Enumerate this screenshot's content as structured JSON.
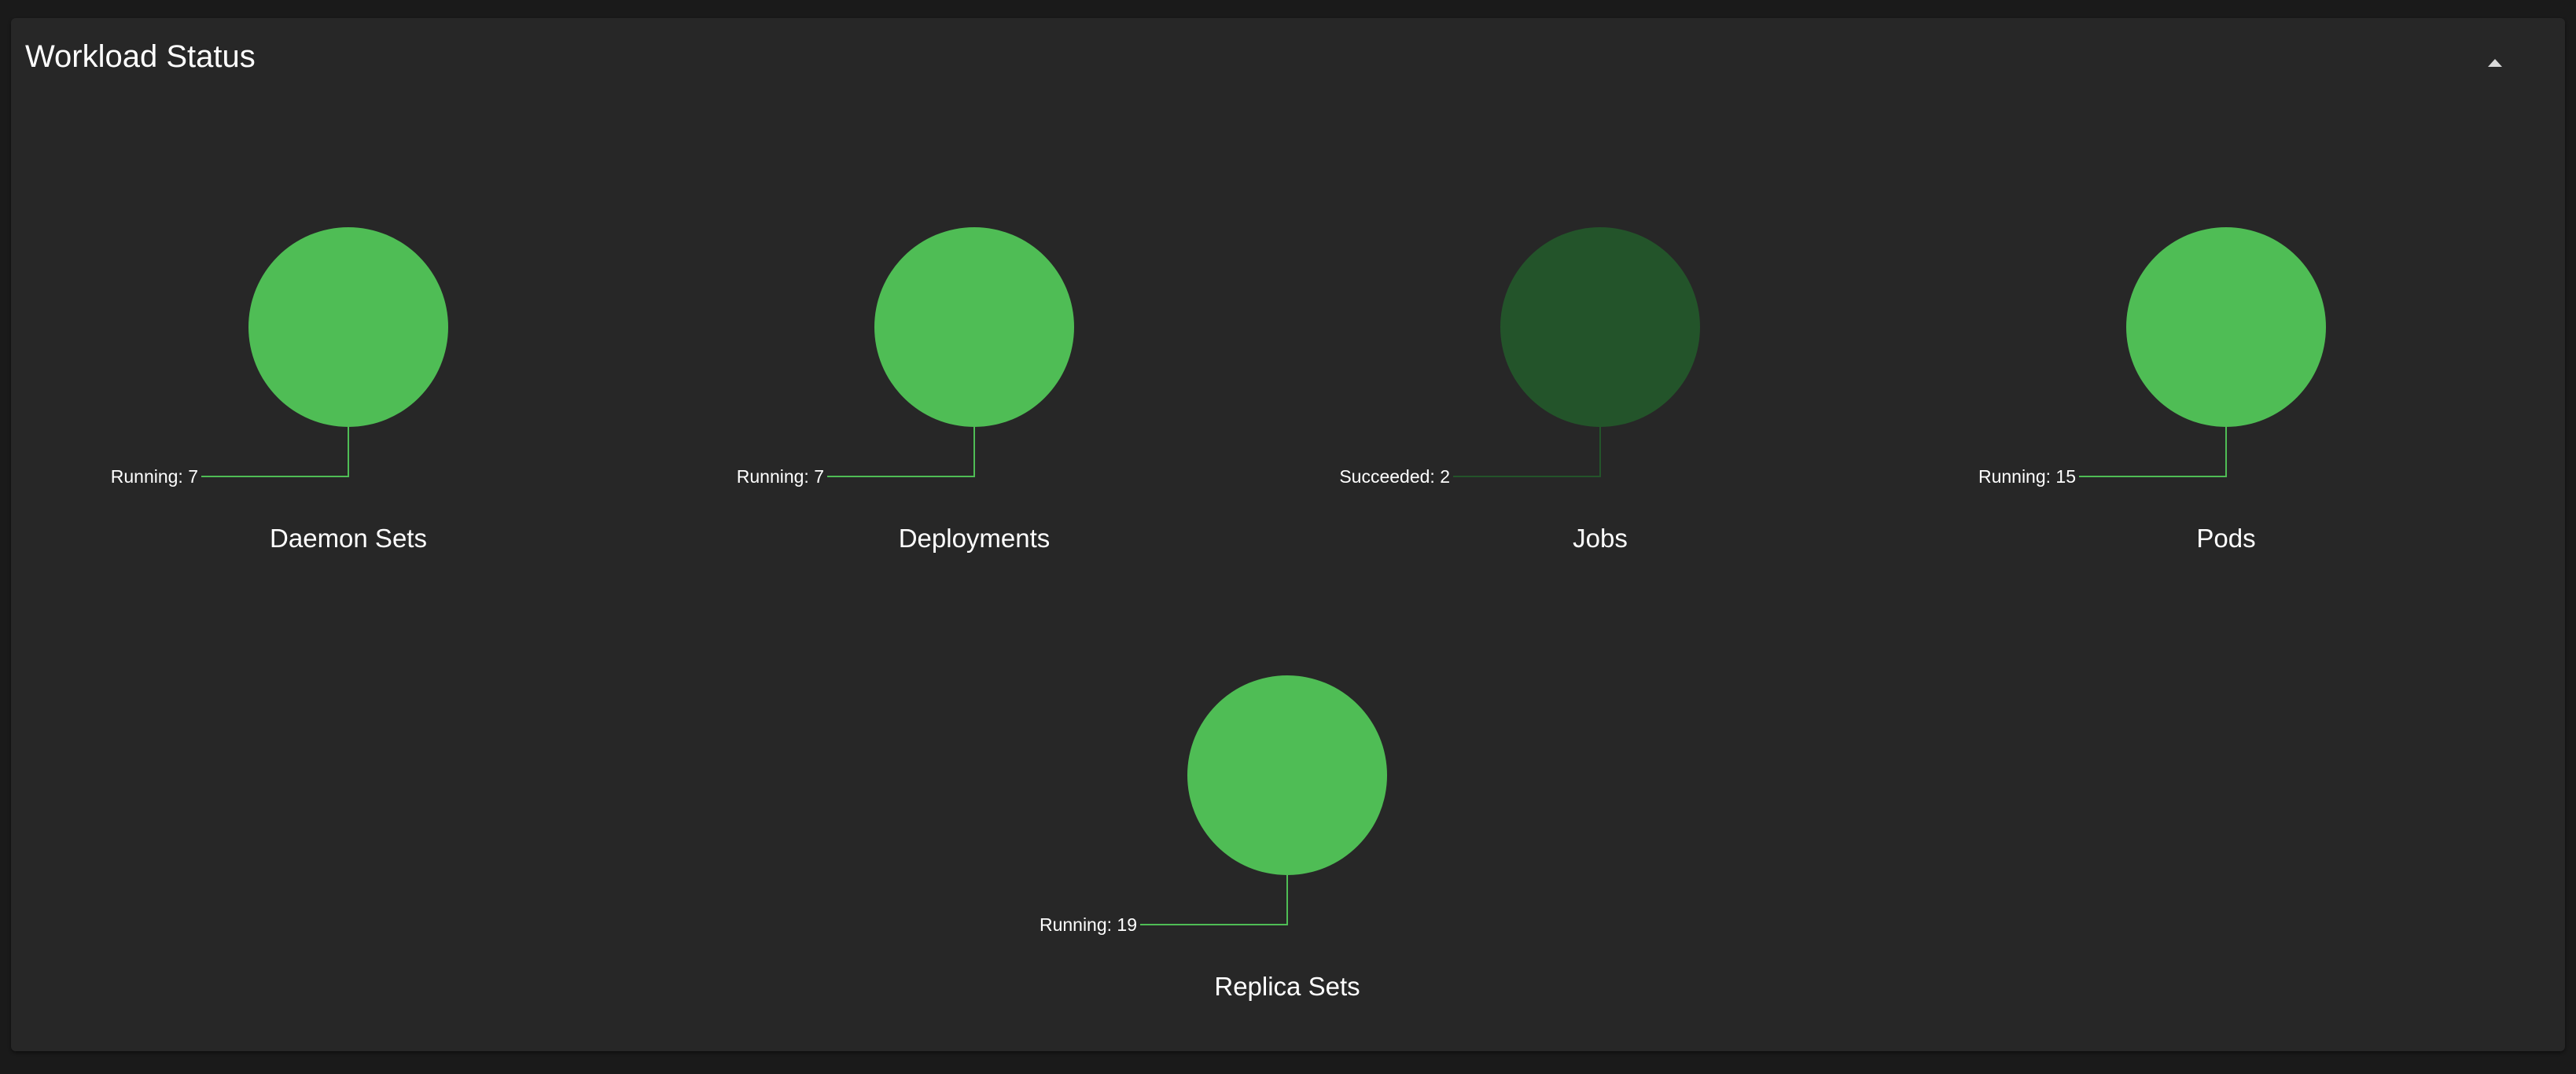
{
  "panel": {
    "title": "Workload Status",
    "collapse_icon": "chevron-up-icon"
  },
  "colors": {
    "running": "#4fbd55",
    "succeeded": "#23542a",
    "background": "#1a1a1a",
    "card": "#272727",
    "text": "#ffffff"
  },
  "chart_data": [
    {
      "type": "pie",
      "title": "Daemon Sets",
      "slices": [
        {
          "label": "Running",
          "value": 7,
          "status": "running"
        }
      ]
    },
    {
      "type": "pie",
      "title": "Deployments",
      "slices": [
        {
          "label": "Running",
          "value": 7,
          "status": "running"
        }
      ]
    },
    {
      "type": "pie",
      "title": "Jobs",
      "slices": [
        {
          "label": "Succeeded",
          "value": 2,
          "status": "succeeded"
        }
      ]
    },
    {
      "type": "pie",
      "title": "Pods",
      "slices": [
        {
          "label": "Running",
          "value": 15,
          "status": "running"
        }
      ]
    },
    {
      "type": "pie",
      "title": "Replica Sets",
      "slices": [
        {
          "label": "Running",
          "value": 19,
          "status": "running"
        }
      ]
    }
  ]
}
